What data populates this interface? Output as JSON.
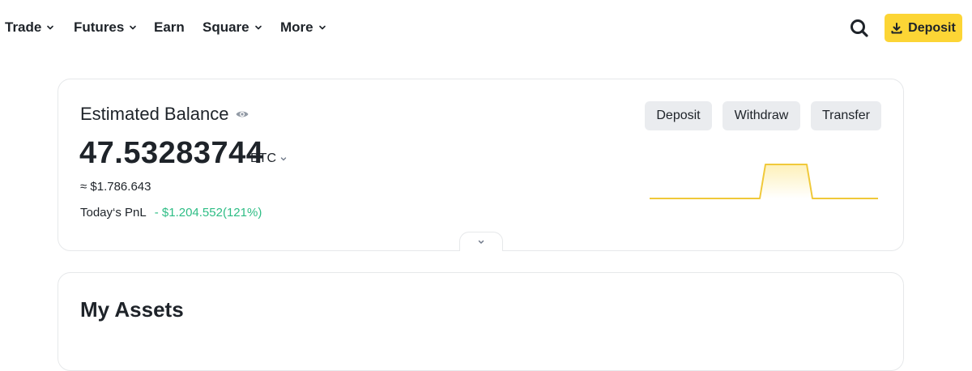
{
  "nav": {
    "items": [
      {
        "label": "Trade",
        "dropdown": true
      },
      {
        "label": "Futures",
        "dropdown": true
      },
      {
        "label": "Earn",
        "dropdown": false
      },
      {
        "label": "Square",
        "dropdown": true
      },
      {
        "label": "More",
        "dropdown": true
      }
    ],
    "search_icon": "search-icon",
    "deposit_label": "Deposit",
    "deposit_icon": "download-icon"
  },
  "balance": {
    "title": "Estimated Balance",
    "visibility_icon": "eye-icon",
    "amount": "47.53283744",
    "unit": "BTC",
    "fiat_value": "≈ $1.786.643",
    "pnl_label": "Today‘s PnL",
    "pnl_value": "- $1.204.552(121%)",
    "actions": {
      "deposit": "Deposit",
      "withdraw": "Withdraw",
      "transfer": "Transfer"
    },
    "sparkline_trend": [
      "flat",
      "rise",
      "flat-high",
      "fall",
      "flat"
    ]
  },
  "assets": {
    "title": "My Assets"
  },
  "colors": {
    "accent": "#fcd535",
    "positive": "#2ebd85",
    "text": "#1e2329",
    "button_bg": "#eaecef",
    "border": "#e6e8ea"
  }
}
